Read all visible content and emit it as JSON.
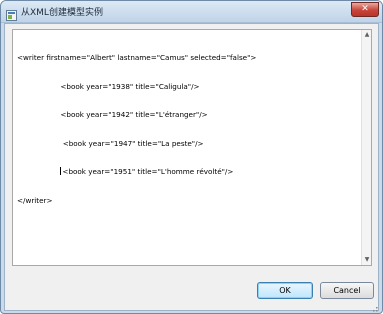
{
  "window": {
    "title": "从XML创建模型实例",
    "close_label": "✕"
  },
  "editor": {
    "lines": [
      "<writer firstname=\"Albert\" lastname=\"Camus\" selected=\"false\">",
      "                   <book year=\"1938\" title=\"Caligula\"/>",
      "                   <book year=\"1942\" title=\"L'étranger\"/>",
      "                    <book year=\"1947\" title=\"La peste\"/>",
      "                   ",
      "</writer>"
    ],
    "caret_line_text": "<book year=\"1951\" title=\"L'homme révolté\"/>",
    "caret_line_indent": "                   "
  },
  "buttons": {
    "ok_label": "OK",
    "cancel_label": "Cancel"
  },
  "icons": {
    "app": "xml-model-icon",
    "scroll_up": "▲",
    "scroll_down": "▼"
  }
}
